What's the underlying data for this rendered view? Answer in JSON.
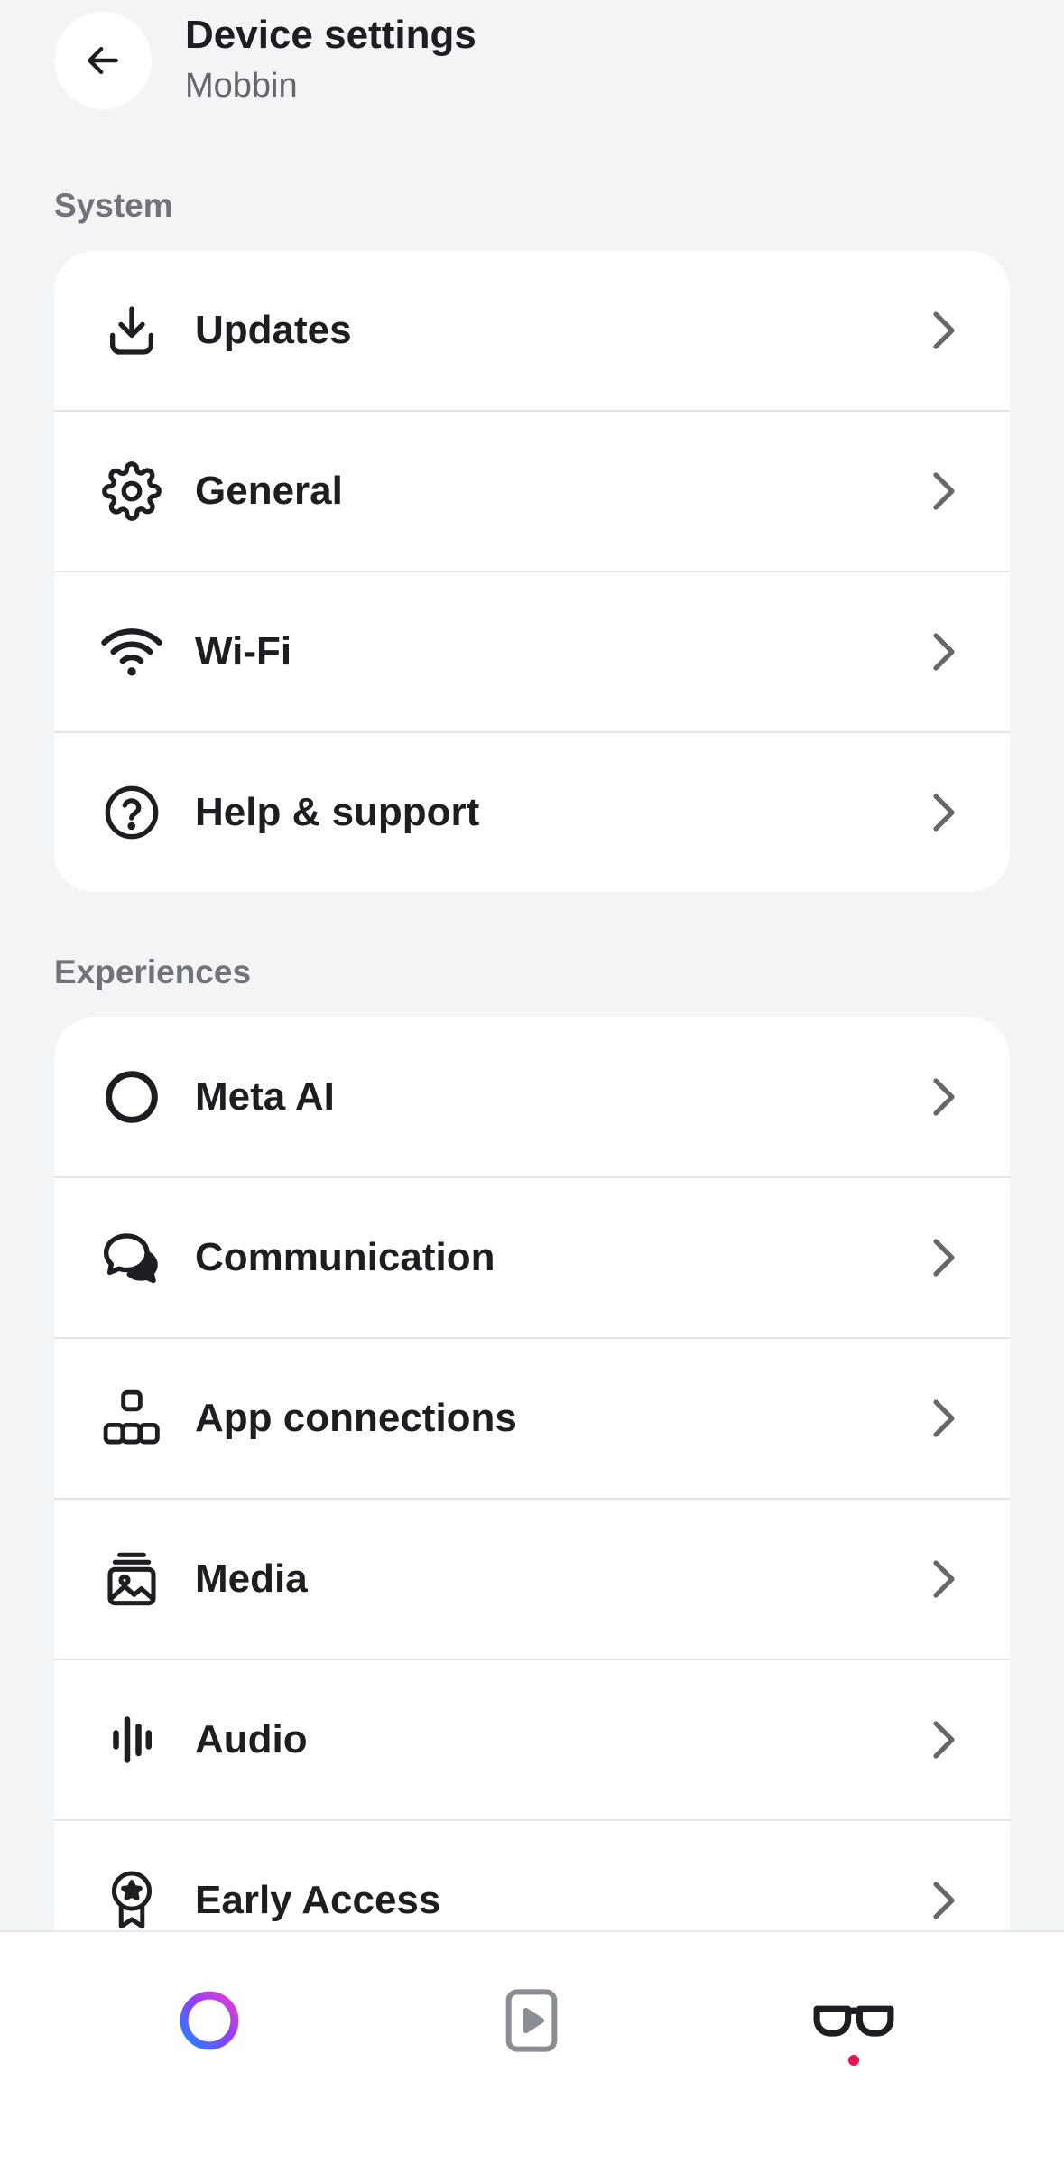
{
  "header": {
    "title": "Device settings",
    "subtitle": "Mobbin",
    "back_icon": "arrow-left-icon"
  },
  "sections": [
    {
      "label": "System",
      "items": [
        {
          "label": "Updates",
          "icon": "download-icon"
        },
        {
          "label": "General",
          "icon": "gear-icon"
        },
        {
          "label": "Wi-Fi",
          "icon": "wifi-icon"
        },
        {
          "label": "Help & support",
          "icon": "help-circle-icon"
        }
      ]
    },
    {
      "label": "Experiences",
      "items": [
        {
          "label": "Meta AI",
          "icon": "meta-ai-ring-icon"
        },
        {
          "label": "Communication",
          "icon": "chat-bubbles-icon"
        },
        {
          "label": "App connections",
          "icon": "apps-grid-icon"
        },
        {
          "label": "Media",
          "icon": "media-stack-icon"
        },
        {
          "label": "Audio",
          "icon": "audio-bars-icon"
        },
        {
          "label": "Early Access",
          "icon": "award-badge-icon"
        }
      ]
    }
  ],
  "bottom_nav": [
    {
      "name": "meta-ai",
      "icon": "meta-ai-gradient-icon",
      "active": false
    },
    {
      "name": "media",
      "icon": "play-square-icon",
      "active": false
    },
    {
      "name": "device",
      "icon": "glasses-icon",
      "active": true
    }
  ],
  "colors": {
    "background": "#f3f4f6",
    "card": "#ffffff",
    "text_primary": "#1c1e21",
    "text_secondary": "#65676b",
    "section_label": "#707378",
    "active_dot": "#e4174f"
  }
}
